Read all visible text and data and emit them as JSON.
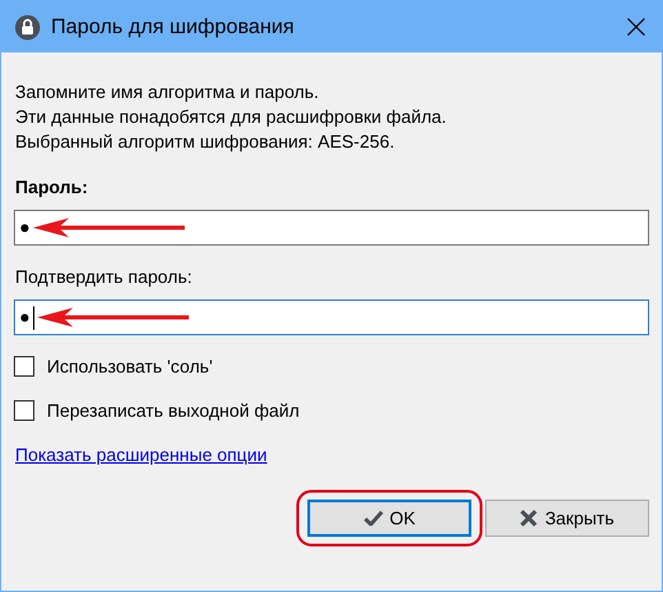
{
  "window": {
    "title": "Пароль для шифрования"
  },
  "intro": [
    "Запомните имя алгоритма и пароль.",
    "Эти данные понадобятся для расшифровки файла.",
    "Выбранный алгоритм шифрования: AES-256."
  ],
  "fields": [
    {
      "label": "Пароль:",
      "bold": true,
      "value": "●",
      "focused": false,
      "annotated": true
    },
    {
      "label": "Подтвердить пароль:",
      "bold": false,
      "value": "●",
      "focused": true,
      "annotated": true
    }
  ],
  "checkboxes": [
    {
      "label": "Использовать 'соль'",
      "checked": false
    },
    {
      "label": "Перезаписать выходной файл",
      "checked": false
    }
  ],
  "link": "Показать расширенные опции",
  "buttons": [
    {
      "kind": "ok",
      "label": "OK",
      "focused": true,
      "highlighted": true
    },
    {
      "kind": "close",
      "label": "Закрыть",
      "focused": false,
      "highlighted": false
    }
  ]
}
